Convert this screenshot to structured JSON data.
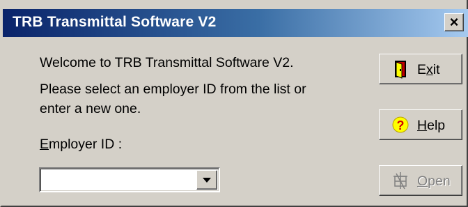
{
  "window": {
    "title": "TRB Transmittal Software V2",
    "close_label": "×"
  },
  "content": {
    "welcome": "Welcome to TRB Transmittal Software V2.",
    "instruction_line1": "Please select an employer ID from the list or",
    "instruction_line2": "enter a new one.",
    "employer_label_mnemonic": "E",
    "employer_label_rest": "mployer ID :"
  },
  "employer_combo": {
    "value": "",
    "options": []
  },
  "buttons": {
    "exit": {
      "pre": "E",
      "mnemonic": "x",
      "post": "it",
      "icon": "exit-door-icon"
    },
    "help": {
      "pre": "",
      "mnemonic": "H",
      "post": "elp",
      "icon": "question-mark-icon"
    },
    "open": {
      "pre": "",
      "mnemonic": "O",
      "post": "pen",
      "icon": "open-folder-icon",
      "enabled": false
    }
  },
  "colors": {
    "titlebar_start": "#0a246a",
    "titlebar_end": "#a6caf0",
    "face": "#d4d0c8",
    "disabled_text": "#808080"
  }
}
